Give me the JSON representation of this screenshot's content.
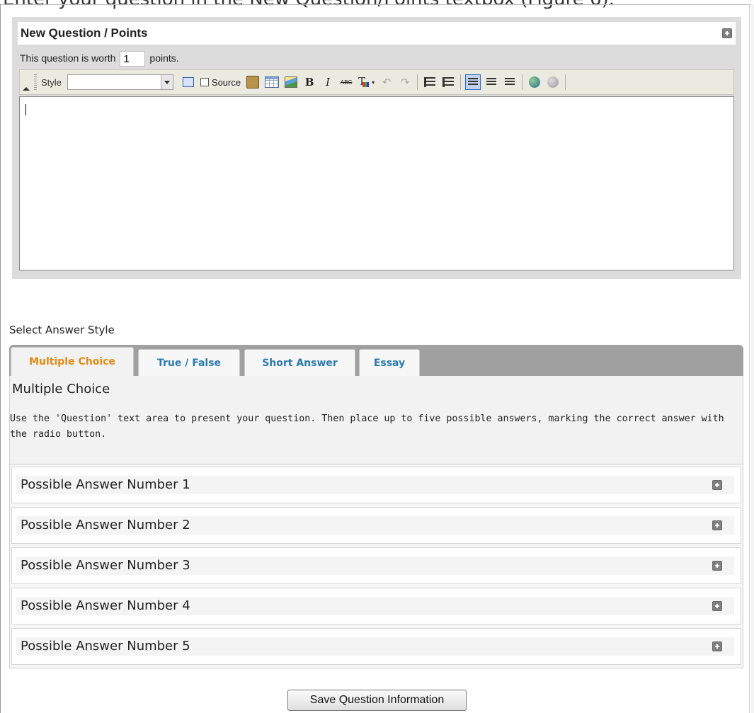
{
  "caption": "Enter your question in the New Question/Points textbox (Figure 6).",
  "question_panel": {
    "title": "New Question / Points",
    "worth_prefix": "This question is worth",
    "points_value": "1",
    "worth_suffix": "points.",
    "toolbar": {
      "style_label": "Style",
      "style_value": "",
      "source_label": "Source",
      "bold_label": "B",
      "italic_label": "I",
      "spellcheck_label": "ABC"
    }
  },
  "answer_style": {
    "label": "Select Answer Style",
    "tabs": [
      {
        "label": "Multiple Choice",
        "active": true
      },
      {
        "label": "True / False",
        "active": false
      },
      {
        "label": "Short Answer",
        "active": false
      },
      {
        "label": "Essay",
        "active": false
      }
    ],
    "panel_title": "Multiple Choice",
    "panel_description": "Use the 'Question' text area to present your question. Then place up to five possible answers, marking the correct answer with the radio button.",
    "answers": [
      {
        "label": "Possible Answer Number 1"
      },
      {
        "label": "Possible Answer Number 2"
      },
      {
        "label": "Possible Answer Number 3"
      },
      {
        "label": "Possible Answer Number 4"
      },
      {
        "label": "Possible Answer Number 5"
      }
    ]
  },
  "save_button": "Save Question Information",
  "colors": {
    "active_tab": "#e38b12",
    "inactive_tab": "#2a7ab0",
    "tab_strip": "#a0a0a0"
  }
}
